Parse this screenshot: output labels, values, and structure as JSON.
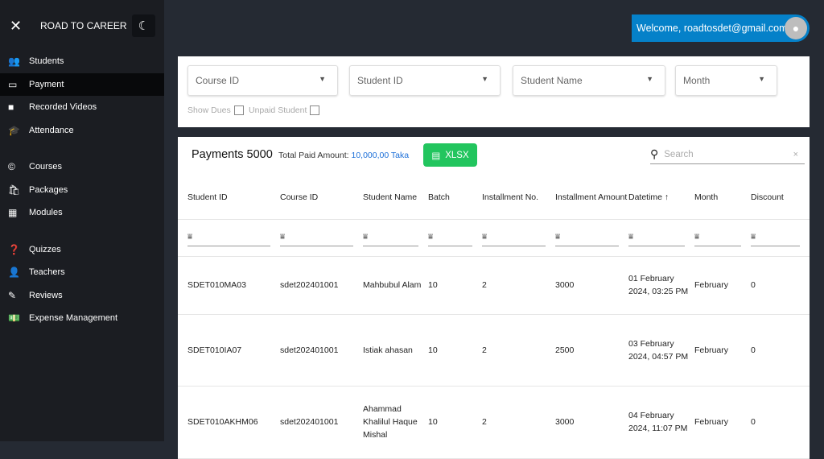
{
  "sidebar": {
    "brand": "ROAD TO CAREER",
    "items": [
      {
        "label": "Students",
        "icon": "👥"
      },
      {
        "label": "Payment",
        "icon": "▭"
      },
      {
        "label": "Recorded Videos",
        "icon": "■"
      },
      {
        "label": "Attendance",
        "icon": "🎓"
      },
      {
        "label": "Courses",
        "icon": "©"
      },
      {
        "label": "Packages",
        "icon": "🛍"
      },
      {
        "label": "Modules",
        "icon": "▦"
      },
      {
        "label": "Quizzes",
        "icon": "❓"
      },
      {
        "label": "Teachers",
        "icon": "👤"
      },
      {
        "label": "Reviews",
        "icon": "✎"
      },
      {
        "label": "Expense Management",
        "icon": "💵"
      }
    ]
  },
  "header": {
    "welcome": "Welcome, roadtosdet@gmail.com"
  },
  "filters": {
    "course_id": "Course ID",
    "student_id": "Student ID",
    "student_name": "Student Name",
    "month": "Month",
    "show_dues": "Show Dues",
    "unpaid_student": "Unpaid Student"
  },
  "payments": {
    "title": "Payments 5000",
    "total_label": "Total Paid Amount:",
    "total_value": "10,000,00 Taka",
    "xlsx": "XLSX",
    "search_placeholder": "Search",
    "columns": [
      "Student ID",
      "Course ID",
      "Student Name",
      "Batch",
      "Installment No.",
      "Installment Amount",
      "Datetime ↑",
      "Month",
      "Discount"
    ],
    "rows": [
      [
        "SDET010MA03",
        "sdet202401001",
        "Mahbubul Alam",
        "10",
        "2",
        "3000",
        "01 February 2024, 03:25 PM",
        "February",
        "0"
      ],
      [
        "SDET010IA07",
        "sdet202401001",
        "Istiak ahasan",
        "10",
        "2",
        "2500",
        "03 February 2024, 04:57 PM",
        "February",
        "0"
      ],
      [
        "SDET010AKHM06",
        "sdet202401001",
        "Ahammad Khalilul Haque Mishal",
        "10",
        "2",
        "3000",
        "04 February 2024, 11:07 PM",
        "February",
        "0"
      ]
    ]
  }
}
